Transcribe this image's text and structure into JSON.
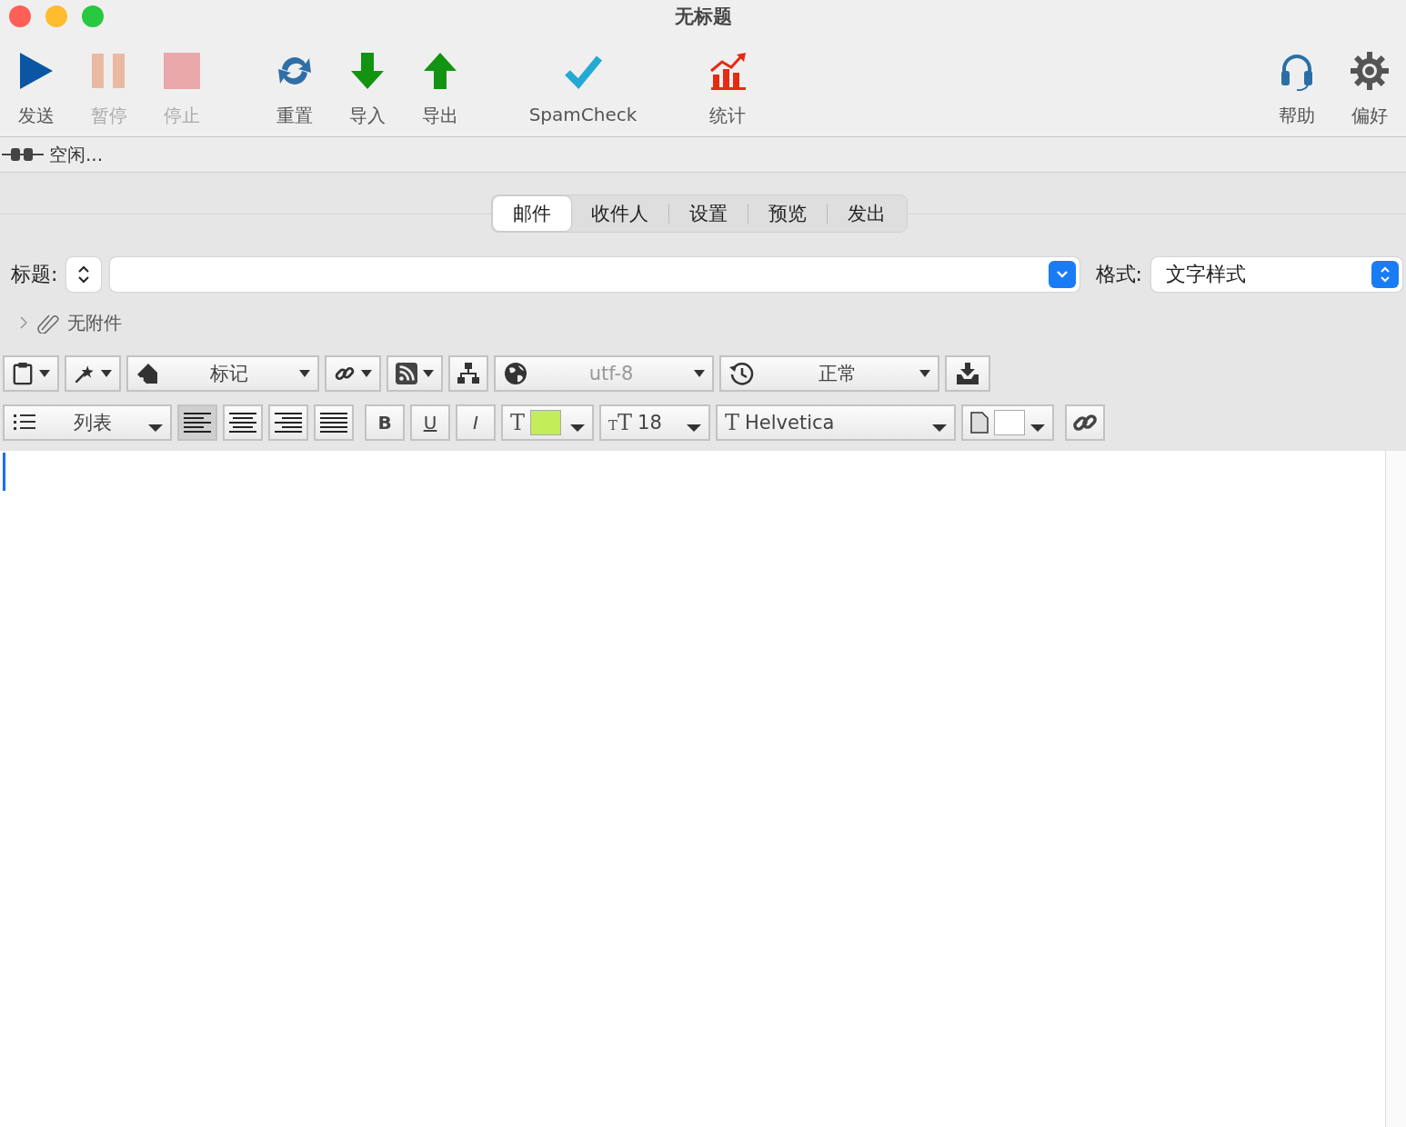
{
  "window": {
    "title": "无标题"
  },
  "toolbar": {
    "left": [
      {
        "label": "发送",
        "disabled": false
      },
      {
        "label": "暂停",
        "disabled": true
      },
      {
        "label": "停止",
        "disabled": true
      },
      {
        "label": "重置",
        "disabled": false
      },
      {
        "label": "导入",
        "disabled": false
      },
      {
        "label": "导出",
        "disabled": false
      },
      {
        "label": "SpamCheck",
        "disabled": false
      },
      {
        "label": "统计",
        "disabled": false
      }
    ],
    "right": [
      {
        "label": "帮助",
        "disabled": false
      },
      {
        "label": "偏好",
        "disabled": false
      }
    ]
  },
  "status": {
    "text": "空闲..."
  },
  "tabs": [
    {
      "label": "邮件",
      "selected": true
    },
    {
      "label": "收件人",
      "selected": false
    },
    {
      "label": "设置",
      "selected": false
    },
    {
      "label": "预览",
      "selected": false
    },
    {
      "label": "发出",
      "selected": false
    }
  ],
  "subject": {
    "label": "标题:"
  },
  "format": {
    "label": "格式:",
    "value": "文字样式"
  },
  "attachments": {
    "label": "无附件",
    "expanded": false
  },
  "edit_bar": {
    "tag": "标记",
    "encoding": "utf-8",
    "encoding_disabled": true,
    "priority": "正常"
  },
  "format_bar": {
    "list": "列表",
    "alignments": [
      {
        "selected": true
      },
      {
        "selected": false
      },
      {
        "selected": false
      },
      {
        "selected": false
      }
    ],
    "bold": "B",
    "underline": "U",
    "italic": "I",
    "color_glyph": "T",
    "size_glyph_small": "T",
    "size_glyph": "T",
    "font_size": "18",
    "font_glyph": "T",
    "font": "Helvetica"
  }
}
